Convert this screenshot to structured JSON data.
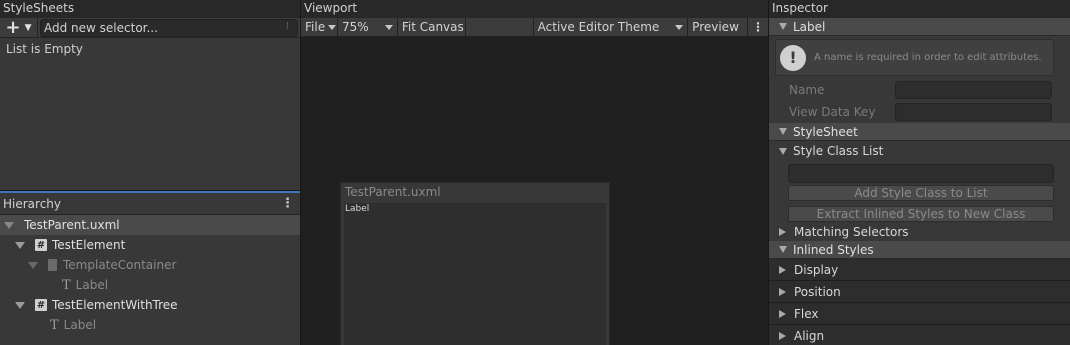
{
  "stylesheets": {
    "title": "StyleSheets",
    "selector_placeholder": "Add new selector...",
    "input_menu_glyph": "⁝",
    "empty_text": "List is Empty"
  },
  "hierarchy": {
    "title": "Hierarchy",
    "menu_glyph": "⋮",
    "items": [
      {
        "label": "TestParent.uxml",
        "icon": "none",
        "expanded": true
      },
      {
        "label": "TestElement",
        "icon": "hash-icon",
        "expanded": true
      },
      {
        "label": "TemplateContainer",
        "icon": "document-icon",
        "expanded": true
      },
      {
        "label": "Label",
        "icon": "text-icon"
      },
      {
        "label": "TestElementWithTree",
        "icon": "hash-icon",
        "expanded": true
      },
      {
        "label": "Label",
        "icon": "text-icon"
      }
    ]
  },
  "viewport": {
    "title": "Viewport",
    "toolbar": {
      "file": "File",
      "zoom": "75%",
      "fit": "Fit Canvas",
      "theme": "Active Editor Theme",
      "preview": "Preview",
      "menu_glyph": "⋮"
    },
    "canvas": {
      "title": "TestParent.uxml",
      "label": "Label"
    }
  },
  "inspector": {
    "title": "Inspector",
    "label_section": "Label",
    "help_text": "A name is required in order to edit attributes.",
    "name_label": "Name",
    "view_data_key_label": "View Data Key",
    "stylesheet_section": "StyleSheet",
    "style_class_list": "Style Class List",
    "add_class_button": "Add Style Class to List",
    "extract_button": "Extract Inlined Styles to New Class",
    "matching_selectors": "Matching Selectors",
    "inlined_styles": "Inlined Styles",
    "groups": [
      "Display",
      "Position",
      "Flex",
      "Align"
    ]
  },
  "colors": {
    "background": "#383838",
    "header": "#282828",
    "selection_accent": "#3a79bb"
  }
}
